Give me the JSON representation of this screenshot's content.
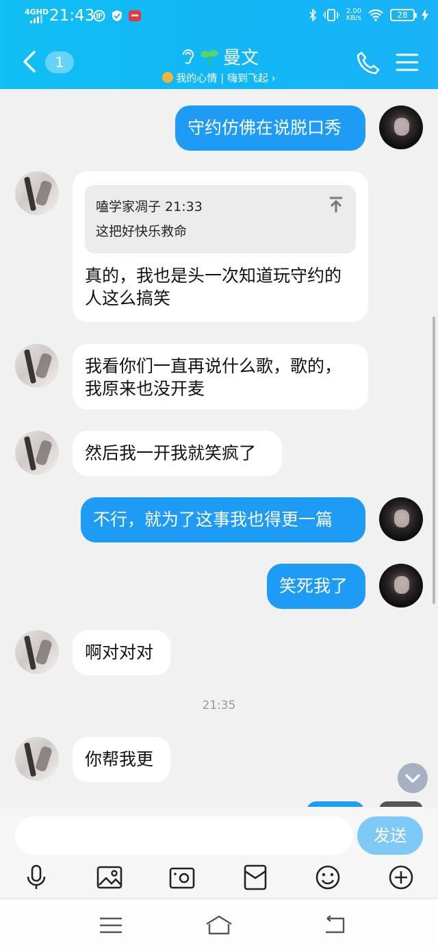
{
  "status_bar": {
    "network": "4GHD",
    "time": "21:43",
    "speed": "2.00",
    "speed_unit": "KB/s",
    "battery": "28"
  },
  "header": {
    "unread_count": "1",
    "title": "曼文",
    "subtitle": "我的心情 | 嗨到飞起 ›"
  },
  "messages": [
    {
      "from": "me",
      "text": "守约仿佛在说脱口秀"
    },
    {
      "from": "other",
      "quote_author": "嗑学家凋子 21:33",
      "quote_text": "这把好快乐救命",
      "text": "真的，我也是头一次知道玩守约的人这么搞笑"
    },
    {
      "from": "other",
      "text": "我看你们一直再说什么歌，歌的，我原来也没开麦"
    },
    {
      "from": "other",
      "text": "然后我一开我就笑疯了"
    },
    {
      "from": "me",
      "text": "不行，就为了这事我也得更一篇"
    },
    {
      "from": "me",
      "text": "笑死我了"
    },
    {
      "from": "other",
      "text": "啊对对对"
    },
    {
      "from": "other",
      "text": "你帮我更"
    }
  ],
  "time_separator": "21:35",
  "input": {
    "placeholder": "",
    "send_label": "发送"
  },
  "toolbar_icons": [
    "microphone-icon",
    "image-icon",
    "camera-icon",
    "red-packet-icon",
    "emoji-icon",
    "plus-icon"
  ],
  "nav_icons": [
    "menu-icon",
    "home-icon",
    "back-icon"
  ],
  "colors": {
    "header": "#11bff3",
    "my_bubble": "#1d9bf5",
    "other_bubble": "#ffffff",
    "background": "#f1f1f1",
    "send_button": "#7fc9f7"
  }
}
